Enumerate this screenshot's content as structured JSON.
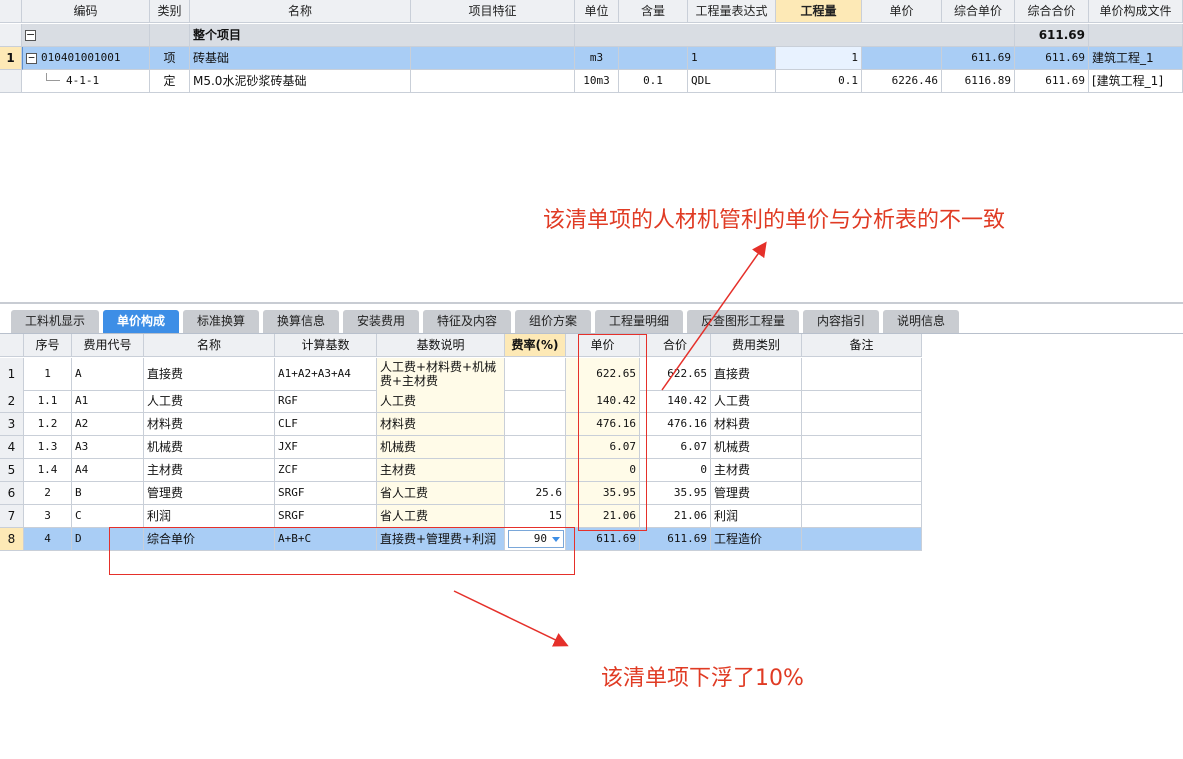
{
  "top_grid": {
    "headers": [
      "",
      "编码",
      "类别",
      "名称",
      "项目特征",
      "单位",
      "含量",
      "工程量表达式",
      "工程量",
      "单价",
      "综合单价",
      "综合合价",
      "单价构成文件"
    ],
    "group_row": {
      "toggle": "−",
      "name": "整个项目",
      "total": "611.69"
    },
    "rows": [
      {
        "rownum": "1",
        "toggle": "−",
        "code": "010401001001",
        "type": "项",
        "name": "砖基础",
        "feature": "",
        "unit": "m3",
        "content": "",
        "expr": "1",
        "qty": "1",
        "price": "",
        "unit_price": "611.69",
        "total": "611.69",
        "file": "建筑工程_1"
      },
      {
        "rownum": "",
        "code": "4-1-1",
        "type": "定",
        "name": "M5.0水泥砂浆砖基础",
        "feature": "",
        "unit": "10m3",
        "content": "0.1",
        "expr": "QDL",
        "qty": "0.1",
        "price": "6226.46",
        "unit_price": "6116.89",
        "total": "611.69",
        "file": "[建筑工程_1]"
      }
    ]
  },
  "tabs": [
    "工料机显示",
    "单价构成",
    "标准换算",
    "换算信息",
    "安装费用",
    "特征及内容",
    "组价方案",
    "工程量明细",
    "反查图形工程量",
    "内容指引",
    "说明信息"
  ],
  "active_tab": "单价构成",
  "bottom_grid": {
    "headers": [
      "",
      "序号",
      "费用代号",
      "名称",
      "计算基数",
      "基数说明",
      "费率(%)",
      "单价",
      "合价",
      "费用类别",
      "备注"
    ],
    "rows": [
      {
        "rownum": "1",
        "seq": "1",
        "code": "A",
        "name": "直接费",
        "base": "A1+A2+A3+A4",
        "desc": "人工费+材料费+机械费+主材费",
        "rate": "",
        "price": "622.65",
        "total": "622.65",
        "category": "直接费",
        "note": ""
      },
      {
        "rownum": "2",
        "seq": "1.1",
        "code": "A1",
        "name": "人工费",
        "base": "RGF",
        "desc": "人工费",
        "rate": "",
        "price": "140.42",
        "total": "140.42",
        "category": "人工费",
        "note": ""
      },
      {
        "rownum": "3",
        "seq": "1.2",
        "code": "A2",
        "name": "材料费",
        "base": "CLF",
        "desc": "材料费",
        "rate": "",
        "price": "476.16",
        "total": "476.16",
        "category": "材料费",
        "note": ""
      },
      {
        "rownum": "4",
        "seq": "1.3",
        "code": "A3",
        "name": "机械费",
        "base": "JXF",
        "desc": "机械费",
        "rate": "",
        "price": "6.07",
        "total": "6.07",
        "category": "机械费",
        "note": ""
      },
      {
        "rownum": "5",
        "seq": "1.4",
        "code": "A4",
        "name": "主材费",
        "base": "ZCF",
        "desc": "主材费",
        "rate": "",
        "price": "0",
        "total": "0",
        "category": "主材费",
        "note": ""
      },
      {
        "rownum": "6",
        "seq": "2",
        "code": "B",
        "name": "管理费",
        "base": "SRGF",
        "desc": "省人工费",
        "rate": "25.6",
        "price": "35.95",
        "total": "35.95",
        "category": "管理费",
        "note": ""
      },
      {
        "rownum": "7",
        "seq": "3",
        "code": "C",
        "name": "利润",
        "base": "SRGF",
        "desc": "省人工费",
        "rate": "15",
        "price": "21.06",
        "total": "21.06",
        "category": "利润",
        "note": ""
      },
      {
        "rownum": "8",
        "seq": "4",
        "code": "D",
        "name": "综合单价",
        "base": "A+B+C",
        "desc": "直接费+管理费+利润",
        "rate": "90",
        "price": "611.69",
        "total": "611.69",
        "category": "工程造价",
        "note": ""
      }
    ]
  },
  "annotations": {
    "top": "该清单项的人材机管利的单价与分析表的不一致",
    "bottom": "该清单项下浮了10%"
  },
  "colors": {
    "annotation_red": "#e5302a",
    "selection_blue": "#a9cdf5",
    "tab_active": "#3d8ee6"
  }
}
